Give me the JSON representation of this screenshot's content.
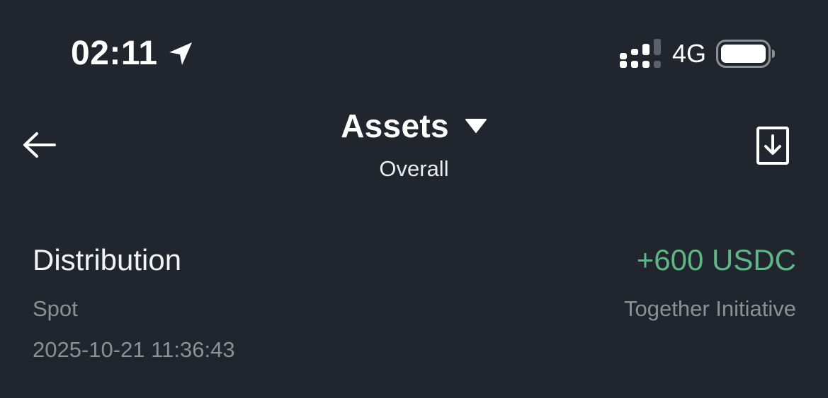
{
  "status_bar": {
    "time": "02:11",
    "network": "4G",
    "icons": [
      "location-arrow-icon",
      "signal-icon",
      "battery-icon"
    ]
  },
  "header": {
    "title": "Assets",
    "subtitle": "Overall",
    "icons": [
      "back-arrow-icon",
      "dropdown-triangle-icon",
      "download-icon"
    ]
  },
  "record": {
    "type": "Distribution",
    "amount": "+600 USDC",
    "account": "Spot",
    "source": "Together Initiative",
    "timestamp": "2025-10-21 11:36:43"
  },
  "colors": {
    "background": "#21252e",
    "positive_amount": "#5fb686",
    "secondary_text": "#8c9198"
  }
}
